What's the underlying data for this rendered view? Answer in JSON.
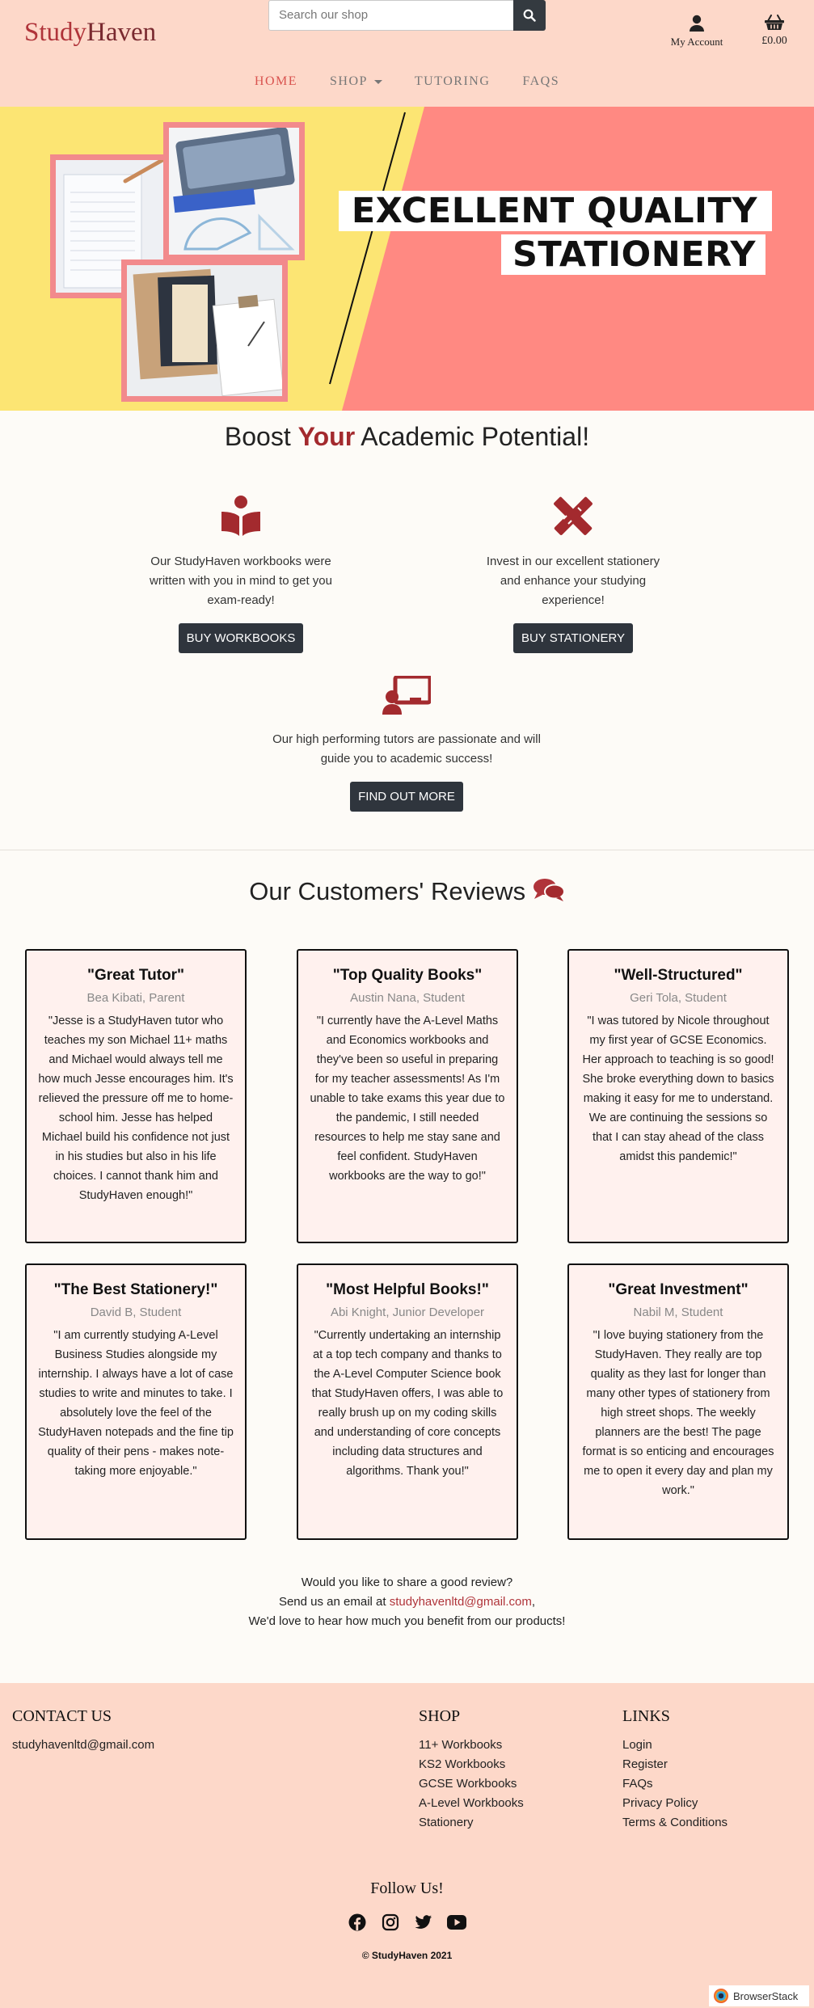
{
  "brand": {
    "part1": "Study",
    "part2": "Haven"
  },
  "search": {
    "placeholder": "Search our shop"
  },
  "account": {
    "label": "My Account"
  },
  "cart": {
    "total": "£0.00"
  },
  "nav": {
    "items": [
      "HOME",
      "SHOP",
      "TUTORING",
      "FAQS"
    ],
    "active": "HOME"
  },
  "hero": {
    "line1": "EXCELLENT QUALITY",
    "line2": "STATIONERY"
  },
  "boost": {
    "pre": "Boost ",
    "highlight": "Your",
    "post": " Academic Potential!"
  },
  "features": [
    {
      "icon": "book-reader-icon",
      "text": "Our StudyHaven workbooks were written with you in mind to get you exam-ready!",
      "button": "BUY WORKBOOKS"
    },
    {
      "icon": "pencil-ruler-icon",
      "text": "Invest in our excellent stationery and enhance your studying experience!",
      "button": "BUY STATIONERY"
    },
    {
      "icon": "chalkboard-teacher-icon",
      "text": "Our high performing tutors are passionate and will guide you to academic success!",
      "button": "FIND OUT MORE"
    }
  ],
  "reviews_title": "Our Customers' Reviews",
  "reviews": [
    {
      "title": "\"Great Tutor\"",
      "author": "Bea Kibati, Parent",
      "text": "\"Jesse is a StudyHaven tutor who teaches my son Michael 11+ maths and Michael would always tell me how much Jesse encourages him. It's relieved the pressure off me to home-school him. Jesse has helped Michael build his confidence not just in his studies but also in his life choices. I cannot thank him and StudyHaven enough!\""
    },
    {
      "title": "\"Top Quality Books\"",
      "author": "Austin Nana, Student",
      "text": "\"I currently have the A-Level Maths and Economics workbooks and they've been so useful in preparing for my teacher assessments! As I'm unable to take exams this year due to the pandemic, I still needed resources to help me stay sane and feel confident. StudyHaven workbooks are the way to go!\""
    },
    {
      "title": "\"Well-Structured\"",
      "author": "Geri Tola, Student",
      "text": "\"I was tutored by Nicole throughout my first year of GCSE Economics. Her approach to teaching is so good! She broke everything down to basics making it easy for me to understand. We are continuing the sessions so that I can stay ahead of the class amidst this pandemic!\""
    },
    {
      "title": "\"The Best Stationery!\"",
      "author": "David B, Student",
      "text": "\"I am currently studying A-Level Business Studies alongside my internship. I always have a lot of case studies to write and minutes to take. I absolutely love the feel of the StudyHaven notepads and the fine tip quality of their pens - makes note-taking more enjoyable.\""
    },
    {
      "title": "\"Most Helpful Books!\"",
      "author": "Abi Knight, Junior Developer",
      "text": "\"Currently undertaking an internship at a top tech company and thanks to the A-Level Computer Science book that StudyHaven offers, I was able to really brush up on my coding skills and understanding of core concepts including data structures and algorithms. Thank you!\""
    },
    {
      "title": "\"Great Investment\"",
      "author": "Nabil M, Student",
      "text": "\"I love buying stationery from the StudyHaven. They really are top quality as they last for longer than many other types of stationery from high street shops. The weekly planners are the best! The page format is so enticing and encourages me to open it every day and plan my work.\""
    }
  ],
  "share": {
    "line1": "Would you like to share a good review?",
    "line2_pre": "Send us an email at ",
    "email": "studyhavenltd@gmail.com",
    "line2_post": ",",
    "line3": "We'd love to hear how much you benefit from our products!"
  },
  "footer": {
    "contact": {
      "heading": "CONTACT US",
      "email": "studyhavenltd@gmail.com"
    },
    "shop": {
      "heading": "SHOP",
      "items": [
        "11+ Workbooks",
        "KS2 Workbooks",
        "GCSE Workbooks",
        "A-Level Workbooks",
        "Stationery"
      ]
    },
    "links": {
      "heading": "LINKS",
      "items": [
        "Login",
        "Register",
        "FAQs",
        "Privacy Policy",
        "Terms & Conditions"
      ]
    },
    "follow": "Follow Us!",
    "social": [
      "facebook-icon",
      "instagram-icon",
      "twitter-icon",
      "youtube-icon"
    ],
    "copyright": "© StudyHaven 2021"
  },
  "badge": "BrowserStack"
}
